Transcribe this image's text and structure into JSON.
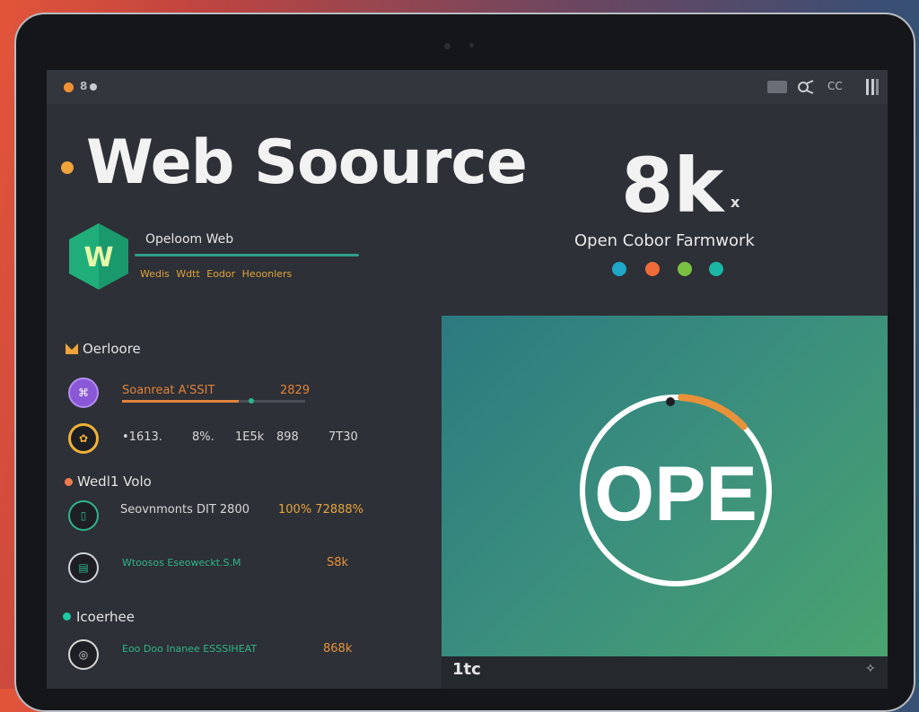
{
  "topbar": {
    "left_label": "8",
    "right_icons": [
      "monitor-icon",
      "share-icon",
      "cc-label",
      "menu-icon"
    ],
    "cc": "CC"
  },
  "hero": {
    "title": "Web Soource",
    "stat": "8k",
    "stat_suffix": "x",
    "subtitle": "Open Cobor Farmwork"
  },
  "brand": {
    "logo_letter": "W",
    "title": "Opeloom Web",
    "tags": "Wedis  Wdtt  Eodor  Heoonlers"
  },
  "palette": [
    "#1ea7c7",
    "#f06a3a",
    "#7bc043",
    "#1bb7a5"
  ],
  "sections": [
    {
      "title": "Oerloore",
      "bullet_color": "#f0a23a",
      "rows": [
        {
          "icon": "code-icon",
          "icon_color": "#8a57d6",
          "title": "Soanreat A'SSIT",
          "value": "2829",
          "color": "#e0823a"
        },
        {
          "icon": "gear-icon",
          "icon_color": "#f0b23a",
          "cells": [
            "•1613.",
            "8%.",
            "1E5k",
            "898",
            "7T30"
          ]
        }
      ]
    },
    {
      "title": "Wedl1 Volo",
      "bullet_color": "#f07a4a",
      "rows": [
        {
          "icon": "mobile-icon",
          "icon_color": "#2fb58c",
          "title": "Seovnmonts DIT 2800",
          "value": "100% 72888%",
          "color": "#e8a43a"
        },
        {
          "icon": "document-icon",
          "icon_color": "#2fb58c",
          "title": "Wtoosos Eseoweckt.S.M",
          "value": "S8k",
          "color": "#e8913a"
        }
      ]
    },
    {
      "title": "Icoerhee",
      "bullet_color": "#1ec7a6",
      "rows": [
        {
          "icon": "globe-icon",
          "icon_color": "#d8d8d8",
          "title": "Eoo Doo Inanee ESSSIHEAT",
          "value": "868k",
          "color": "#e8913a"
        }
      ]
    }
  ],
  "panel": {
    "ring_label": "OPE",
    "progress": 0.12,
    "footer_left": "1tc",
    "footer_icon": "settings-icon"
  }
}
